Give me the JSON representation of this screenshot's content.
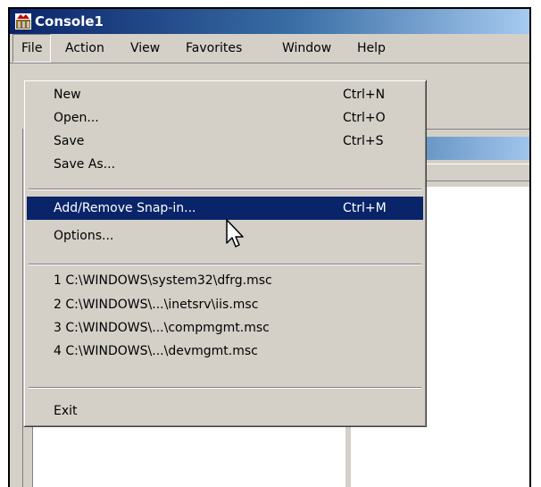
{
  "window": {
    "title": "Console1"
  },
  "menubar": {
    "items": [
      "File",
      "Action",
      "View",
      "Favorites",
      "Window",
      "Help"
    ]
  },
  "file_menu": {
    "items": [
      {
        "label": "New",
        "shortcut": "Ctrl+N"
      },
      {
        "label": "Open...",
        "shortcut": "Ctrl+O"
      },
      {
        "label": "Save",
        "shortcut": "Ctrl+S"
      },
      {
        "label": "Save As...",
        "shortcut": ""
      },
      {
        "label": "Add/Remove Snap-in...",
        "shortcut": "Ctrl+M",
        "highlighted": true
      },
      {
        "label": "Options...",
        "shortcut": ""
      },
      {
        "label": "1 C:\\WINDOWS\\system32\\dfrg.msc",
        "shortcut": ""
      },
      {
        "label": "2 C:\\WINDOWS\\...\\inetsrv\\iis.msc",
        "shortcut": ""
      },
      {
        "label": "3 C:\\WINDOWS\\...\\compmgmt.msc",
        "shortcut": ""
      },
      {
        "label": "4 C:\\WINDOWS\\...\\devmgmt.msc",
        "shortcut": ""
      },
      {
        "label": "Exit",
        "shortcut": ""
      }
    ]
  },
  "icons": {
    "app": "mmc-console-icon",
    "cursor": "arrow-cursor-icon"
  },
  "colors": {
    "selection": "#0a246a",
    "face": "#d4d0c8",
    "titlebar": "#0a246a"
  }
}
